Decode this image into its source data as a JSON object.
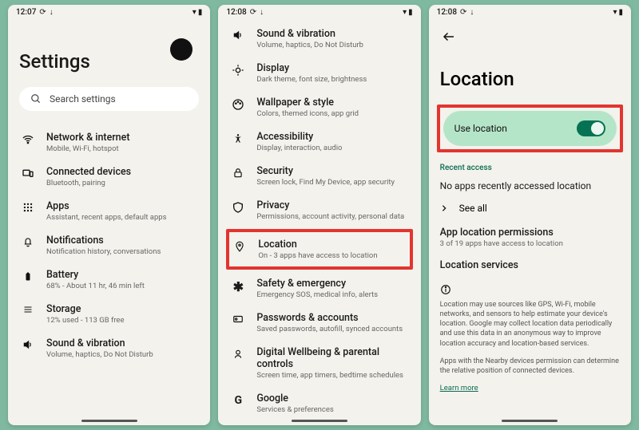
{
  "screen1": {
    "time": "12:07",
    "title": "Settings",
    "search_placeholder": "Search settings",
    "items": [
      {
        "title": "Network & internet",
        "sub": "Mobile, Wi-Fi, hotspot"
      },
      {
        "title": "Connected devices",
        "sub": "Bluetooth, pairing"
      },
      {
        "title": "Apps",
        "sub": "Assistant, recent apps, default apps"
      },
      {
        "title": "Notifications",
        "sub": "Notification history, conversations"
      },
      {
        "title": "Battery",
        "sub": "68% - About 11 hr, 46 min left"
      },
      {
        "title": "Storage",
        "sub": "12% used - 113 GB free"
      },
      {
        "title": "Sound & vibration",
        "sub": "Volume, haptics, Do Not Disturb"
      }
    ]
  },
  "screen2": {
    "time": "12:08",
    "items": [
      {
        "title": "Sound & vibration",
        "sub": "Volume, haptics, Do Not Disturb"
      },
      {
        "title": "Display",
        "sub": "Dark theme, font size, brightness"
      },
      {
        "title": "Wallpaper & style",
        "sub": "Colors, themed icons, app grid"
      },
      {
        "title": "Accessibility",
        "sub": "Display, interaction, audio"
      },
      {
        "title": "Security",
        "sub": "Screen lock, Find My Device, app security"
      },
      {
        "title": "Privacy",
        "sub": "Permissions, account activity, personal data"
      },
      {
        "title": "Location",
        "sub": "On - 3 apps have access to location"
      },
      {
        "title": "Safety & emergency",
        "sub": "Emergency SOS, medical info, alerts"
      },
      {
        "title": "Passwords & accounts",
        "sub": "Saved passwords, autofill, synced accounts"
      },
      {
        "title": "Digital Wellbeing & parental controls",
        "sub": "Screen time, app timers, bedtime schedules"
      },
      {
        "title": "Google",
        "sub": "Services & preferences"
      }
    ]
  },
  "screen3": {
    "time": "12:08",
    "title": "Location",
    "use_location": "Use location",
    "recent_access": "Recent access",
    "no_apps": "No apps recently accessed location",
    "see_all": "See all",
    "app_perms_title": "App location permissions",
    "app_perms_sub": "3 of 19 apps have access to location",
    "loc_services": "Location services",
    "info1": "Location may use sources like GPS, Wi-Fi, mobile networks, and sensors to help estimate your device's location. Google may collect location data periodically and use this data in an anonymous way to improve location accuracy and location-based services.",
    "info2": "Apps with the Nearby devices permission can determine the relative position of connected devices.",
    "learn": "Learn more"
  }
}
